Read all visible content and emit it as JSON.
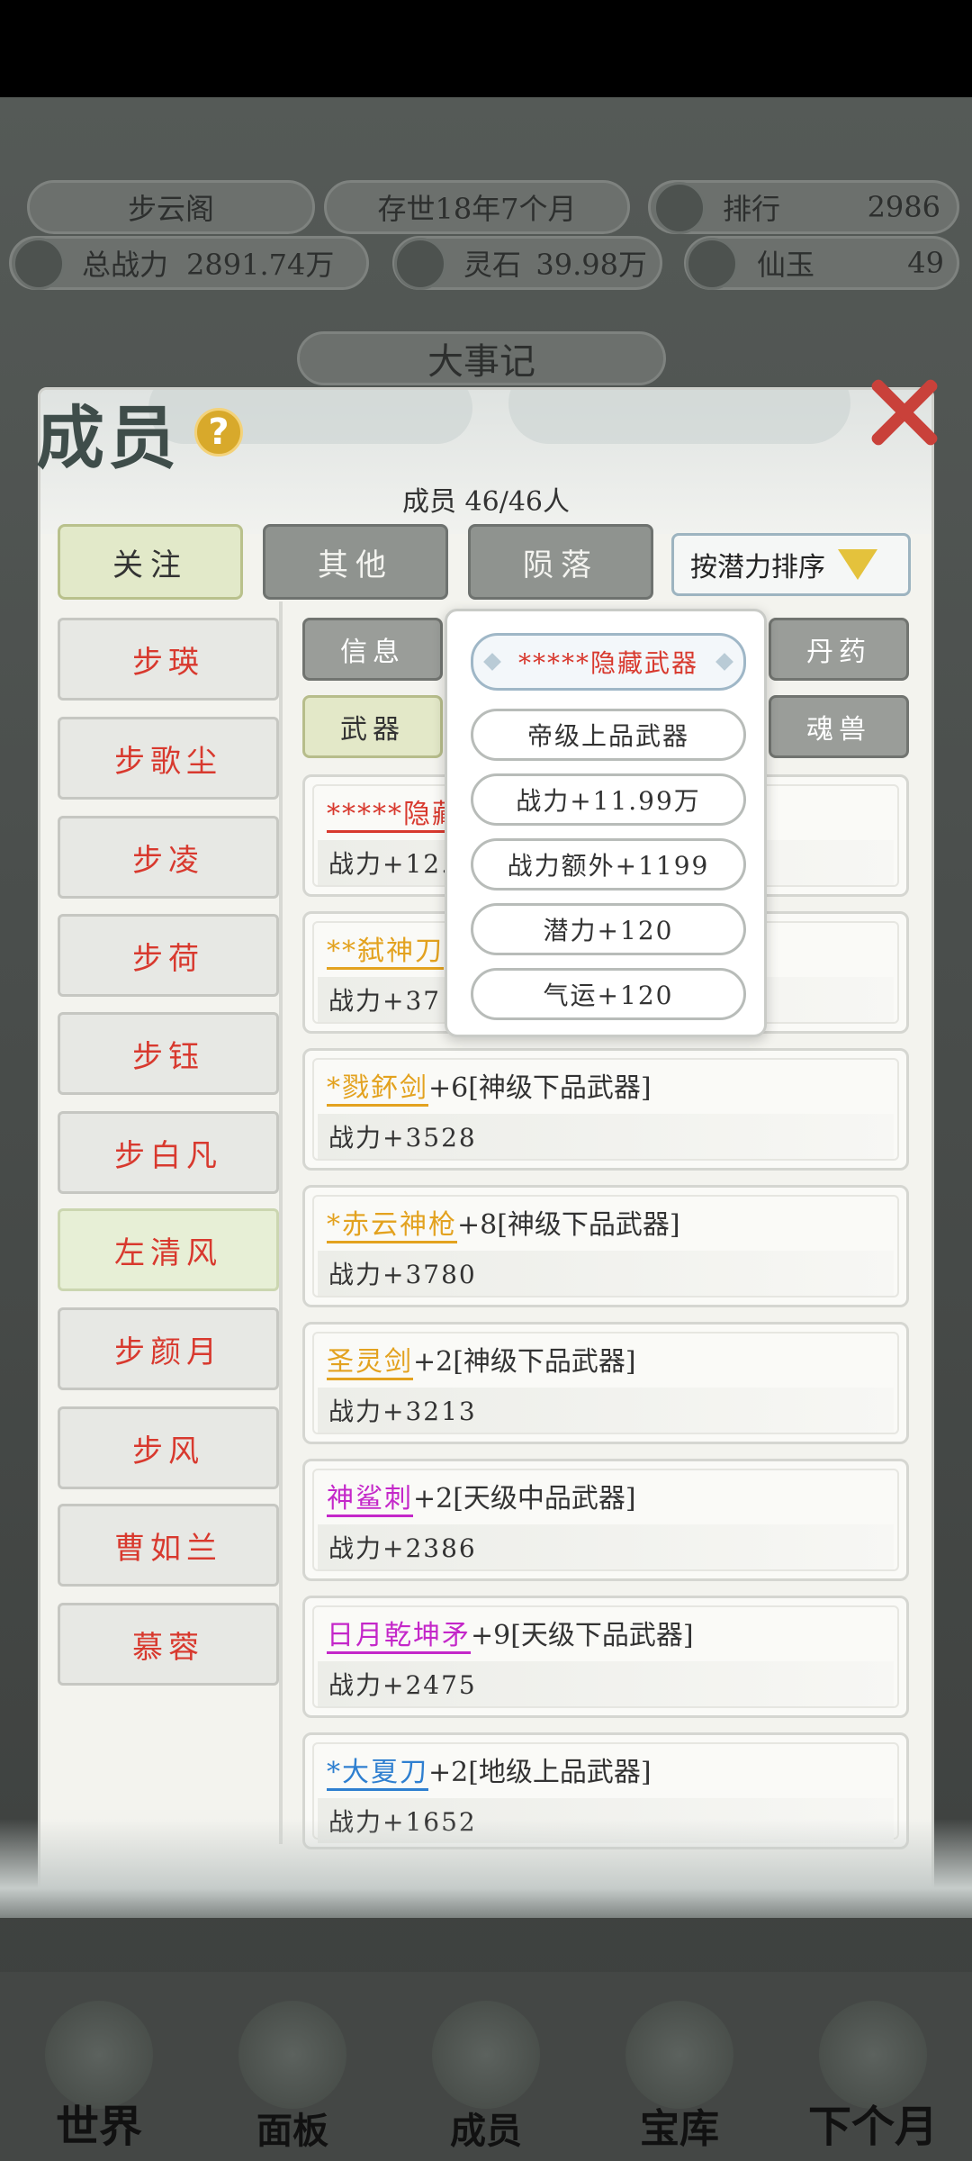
{
  "top": {
    "sect_name": "步云阁",
    "existence": "存世18年7个月",
    "rank_label": "排行",
    "rank_value": "2986",
    "power_label": "总战力",
    "power_value": "2891.74万",
    "spirit_stone_label": "灵石",
    "spirit_stone_value": "39.98万",
    "jade_label": "仙玉",
    "jade_value": "49",
    "chronicle_label": "大事记"
  },
  "panel": {
    "title": "成员",
    "help": "?",
    "member_count": "成员 46/46人",
    "tabs": [
      "关注",
      "其他",
      "陨落"
    ],
    "sort_label": "按潜力排序"
  },
  "members": [
    "步瑛",
    "步歌尘",
    "步凌",
    "步荷",
    "步钰",
    "步白凡",
    "左清风",
    "步颜月",
    "步风",
    "曹如兰",
    "慕蓉"
  ],
  "subtabs": {
    "info": "信息",
    "pill": "丹药",
    "weapon": "武器",
    "beast": "魂兽"
  },
  "cards": [
    {
      "prefix": "*****",
      "name": "隐藏",
      "rest": "",
      "stat": "战力+12.",
      "color": "#d8392e"
    },
    {
      "prefix": "**",
      "name": "弑神刀",
      "rest": "",
      "stat": "战力+37",
      "color": "#e3a21f"
    },
    {
      "prefix": "*",
      "name": "戮鈈剑",
      "rest": "+6[神级下品武器]",
      "stat": "战力+3528",
      "color": "#e3a21f"
    },
    {
      "prefix": "*",
      "name": "赤云神枪",
      "rest": "+8[神级下品武器]",
      "stat": "战力+3780",
      "color": "#e3a21f"
    },
    {
      "prefix": "",
      "name": "圣灵剑",
      "rest": "+2[神级下品武器]",
      "stat": "战力+3213",
      "color": "#e3a21f"
    },
    {
      "prefix": "",
      "name": "神鲨刺",
      "rest": "+2[天级中品武器]",
      "stat": "战力+2386",
      "color": "#c427c9"
    },
    {
      "prefix": "",
      "name": "日月乾坤矛",
      "rest": "+9[天级下品武器]",
      "stat": "战力+2475",
      "color": "#c427c9"
    },
    {
      "prefix": "*",
      "name": "大夏刀",
      "rest": "+2[地级上品武器]",
      "stat": "战力+1652",
      "color": "#2e7fd0"
    }
  ],
  "popup": {
    "title": "*****隐藏武器",
    "lines": [
      "帝级上品武器",
      "战力+11.99万",
      "战力额外+1199",
      "潜力+120",
      "气运+120"
    ]
  },
  "nav": [
    "世界",
    "面板",
    "成员",
    "宝库",
    "下个月"
  ]
}
